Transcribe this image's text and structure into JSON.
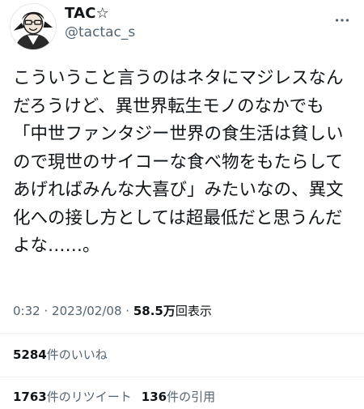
{
  "tweet": {
    "author": {
      "display_name": "TAC☆",
      "handle": "@tactac_s",
      "avatar_icon": "avatar-icon"
    },
    "text": "こういうこと言うのはネタにマジレスなんだろうけど、異世界転生モノのなかでも「中世ファンタジー世界の食生活は貧しいので現世のサイコーな食べ物をもたらしてあげればみんな大喜び」みたいなの、異文化への接し方としては超最低だと思うんだよな……。",
    "time": "0:32",
    "separator": "·",
    "date": "2023/02/08",
    "separator2": "·",
    "views_count": "58.5万",
    "views_label": "回表示",
    "likes": {
      "count": "5284",
      "label": "件のいいね"
    },
    "retweets": {
      "count": "1763",
      "label": "件のリツイート"
    },
    "quotes": {
      "count": "136",
      "label": "件の引用"
    }
  },
  "colors": {
    "text_primary": "#0f1419",
    "text_secondary": "#536471",
    "divider": "#eff3f4"
  },
  "icons": {
    "more": "more-icon"
  }
}
